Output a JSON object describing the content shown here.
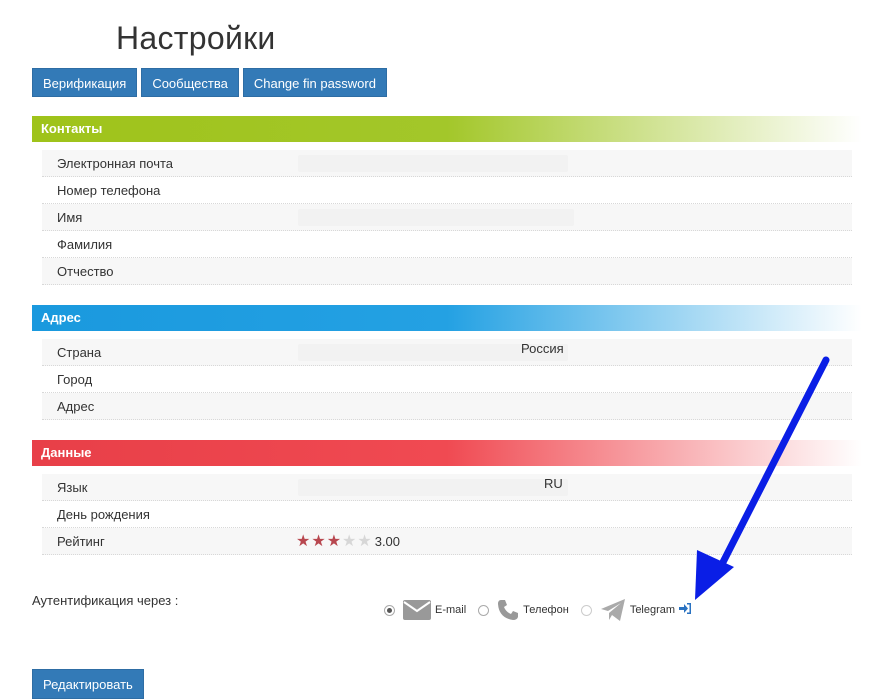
{
  "page_title": "Настройки",
  "tabs": [
    {
      "label": "Верификация"
    },
    {
      "label": "Сообщества"
    },
    {
      "label": "Change fin password"
    }
  ],
  "sections": {
    "contacts": {
      "title": "Контакты",
      "color": "#9fc31a",
      "rows": [
        {
          "label": "Электронная почта",
          "value": ""
        },
        {
          "label": "Номер телефона",
          "value": ""
        },
        {
          "label": "Имя",
          "value": ""
        },
        {
          "label": "Фамилия",
          "value": ""
        },
        {
          "label": "Отчество",
          "value": ""
        }
      ]
    },
    "address": {
      "title": "Адрес",
      "color": "#1a99de",
      "rows": [
        {
          "label": "Страна",
          "value": "Россия"
        },
        {
          "label": "Город",
          "value": ""
        },
        {
          "label": "Адрес",
          "value": ""
        }
      ]
    },
    "data": {
      "title": "Данные",
      "color": "#e83f48",
      "rows": [
        {
          "label": "Язык",
          "value": "RU"
        },
        {
          "label": "День рождения",
          "value": ""
        },
        {
          "label": "Рейтинг",
          "value": "3.00"
        }
      ],
      "rating_stars": 3,
      "rating_max": 5
    }
  },
  "auth": {
    "label": "Аутентификация через :",
    "options": [
      {
        "label": "E-mail",
        "icon": "envelope-icon",
        "selected": true
      },
      {
        "label": "Телефон",
        "icon": "phone-icon",
        "selected": false
      },
      {
        "label": "Telegram",
        "icon": "telegram-icon",
        "selected": false
      }
    ],
    "login_icon": "sign-in-icon"
  },
  "edit_button": "Редактировать",
  "colors": {
    "button": "#337ab7",
    "annotation_arrow": "#0a1ee6"
  }
}
